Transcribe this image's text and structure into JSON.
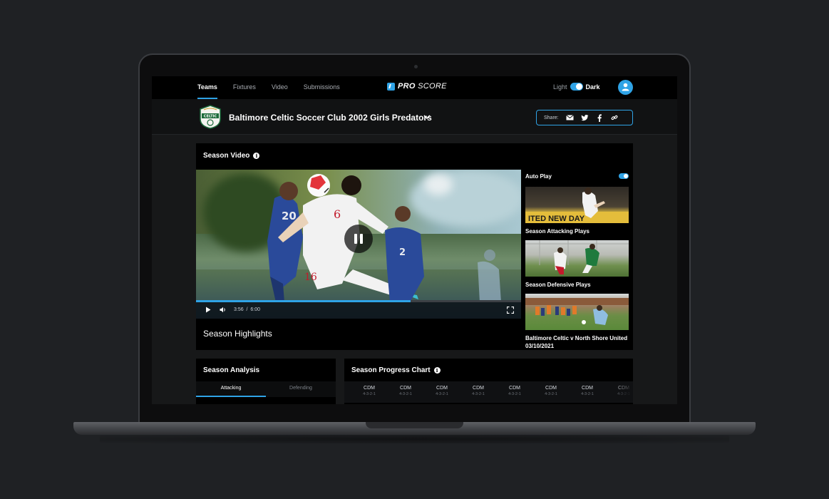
{
  "nav": {
    "tabs": [
      {
        "label": "Teams",
        "active": true
      },
      {
        "label": "Fixtures",
        "active": false
      },
      {
        "label": "Video",
        "active": false
      },
      {
        "label": "Submissions",
        "active": false
      }
    ],
    "brand_primary": "PRO",
    "brand_secondary": "SCORE",
    "theme_light_label": "Light",
    "theme_dark_label": "Dark",
    "theme": "dark"
  },
  "team": {
    "name": "Baltimore Celtic Soccer Club 2002 Girls Predators",
    "crest_text": "CELTIC",
    "share_label": "Share:",
    "share_icons": [
      "mail-icon",
      "twitter-icon",
      "facebook-icon",
      "link-icon"
    ]
  },
  "season_video": {
    "title": "Season Video",
    "caption": "Season Highlights",
    "current_time": "3:56",
    "separator": "/",
    "duration": "6:00",
    "progress_fraction": 0.66,
    "state": "playing",
    "autoplay_label": "Auto Play",
    "autoplay_on": true,
    "playlist": [
      {
        "label": "Season Attacking Plays",
        "banner": "ITED NEW DAY"
      },
      {
        "label": "Season Defensive Plays"
      },
      {
        "label": "Baltimore Celtic v North Shore United 03/10/2021"
      }
    ]
  },
  "season_analysis": {
    "title": "Season Analysis",
    "tabs": [
      {
        "label": "Attacking",
        "active": true
      },
      {
        "label": "Defending",
        "active": false
      }
    ]
  },
  "season_progress": {
    "title": "Season Progress Chart",
    "columns": [
      {
        "position": "CDM",
        "formation": "4-3-2-1"
      },
      {
        "position": "CDM",
        "formation": "4-3-2-1"
      },
      {
        "position": "CDM",
        "formation": "4-3-2-1"
      },
      {
        "position": "CDM",
        "formation": "4-3-2-1"
      },
      {
        "position": "CDM",
        "formation": "4-3-2-1"
      },
      {
        "position": "CDM",
        "formation": "4-3-2-1"
      },
      {
        "position": "CDM",
        "formation": "4-3-2-1"
      },
      {
        "position": "CDM",
        "formation": "4-3-2-1"
      }
    ]
  },
  "colors": {
    "accent": "#2fa3e6",
    "background": "#1f2124",
    "card": "#000000"
  }
}
